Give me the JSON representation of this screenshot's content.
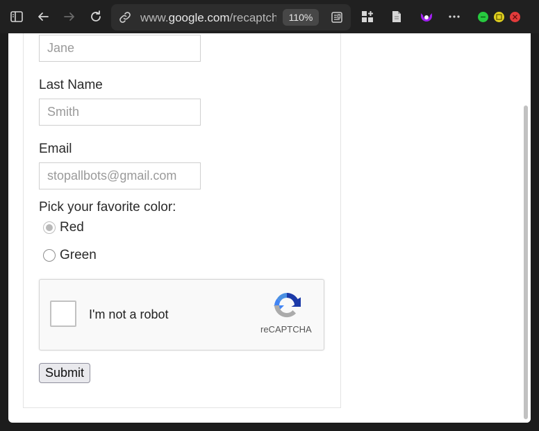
{
  "browser": {
    "url_prefix": "www.",
    "url_host": "google.com",
    "url_path": "/recaptcha",
    "zoom": "110%",
    "colors": {
      "toolbar": "#202020",
      "address_bar": "#2d2d2d",
      "accent_purple": "#a020f0",
      "win_min": "#27c93f",
      "win_max": "#e0d020",
      "win_close": "#e23b3b"
    }
  },
  "form": {
    "first_name": {
      "value": "",
      "placeholder": "Jane"
    },
    "last_name": {
      "label": "Last Name",
      "value": "",
      "placeholder": "Smith"
    },
    "email": {
      "label": "Email",
      "value": "",
      "placeholder": "stopallbots@gmail.com"
    },
    "color_question": "Pick your favorite color:",
    "color_options": [
      {
        "label": "Red",
        "selected": true
      },
      {
        "label": "Green",
        "selected": false
      }
    ],
    "captcha": {
      "label": "I'm not a robot",
      "brand": "reCAPTCHA",
      "checked": false
    },
    "submit_label": "Submit"
  },
  "icons": {
    "sidebar": "sidebar-toggle-icon",
    "back": "back-arrow-icon",
    "forward": "forward-arrow-icon",
    "reload": "reload-icon",
    "site_info": "link-icon",
    "reader": "reader-view-icon",
    "extensions": "apps-add-icon",
    "page": "document-icon",
    "app": "purple-app-icon",
    "more": "more-options-icon"
  }
}
